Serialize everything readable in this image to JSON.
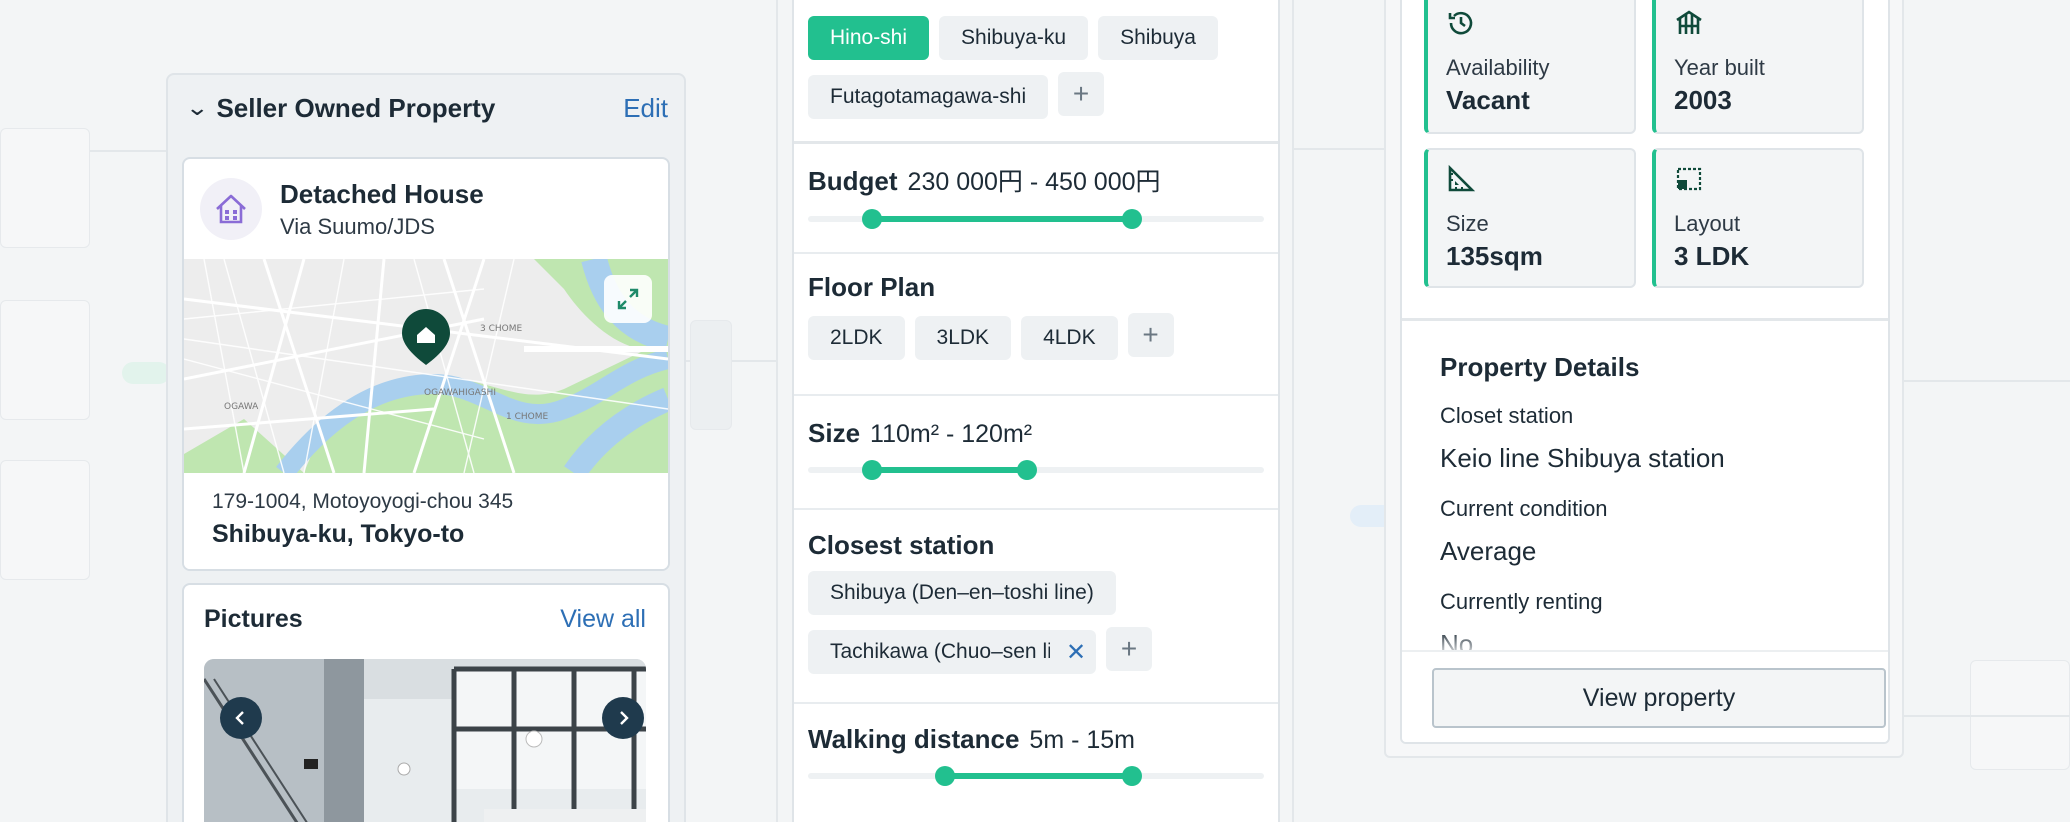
{
  "seller_card": {
    "title": "Seller Owned Property",
    "edit_label": "Edit",
    "property_type": "Detached House",
    "source": "Via Suumo/JDS",
    "address_line1": "179-1004, Motoyoyogi-chou 345",
    "address_line2": "Shibuya-ku, Tokyo-to",
    "pictures_title": "Pictures",
    "view_all_label": "View all"
  },
  "filters": {
    "areas": [
      "Hino-shi",
      "Shibuya-ku",
      "Shibuya",
      "Futagotamagawa-shi"
    ],
    "active_area": "Hino-shi",
    "budget": {
      "label": "Budget",
      "value": "230 000円 - 450 000円",
      "range": [
        0.14,
        0.71
      ]
    },
    "floor_plan": {
      "label": "Floor Plan",
      "options": [
        "2LDK",
        "3LDK",
        "4LDK"
      ]
    },
    "size": {
      "label": "Size",
      "value": "110m² - 120m²",
      "range": [
        0.14,
        0.48
      ]
    },
    "closest_station": {
      "label": "Closest station",
      "options": [
        "Shibuya (Den–en–toshi line)",
        "Tachikawa (Chuo–sen line)"
      ]
    },
    "walking_distance": {
      "label": "Walking distance",
      "value": "5m - 15m",
      "range": [
        0.3,
        0.71
      ]
    }
  },
  "property": {
    "stats": [
      {
        "icon": "clock-history-icon",
        "label": "Availability",
        "value": "Vacant"
      },
      {
        "icon": "building-frame-icon",
        "label": "Year built",
        "value": "2003"
      },
      {
        "icon": "ruler-triangle-icon",
        "label": "Size",
        "value": "135sqm"
      },
      {
        "icon": "layout-icon",
        "label": "Layout",
        "value": "3 LDK"
      }
    ],
    "details_title": "Property Details",
    "details": [
      {
        "label": "Closet station",
        "value": "Keio line Shibuya station"
      },
      {
        "label": "Current condition",
        "value": "Average"
      },
      {
        "label": "Currently renting",
        "value": "No"
      }
    ],
    "view_button_label": "View property"
  },
  "map_labels": [
    "OGAWA",
    "OGAWAHIGASHI",
    "3 CHOME",
    "1 CHOME"
  ],
  "colors": {
    "accent": "#22c08f",
    "link": "#2d6fb5",
    "text": "#1d2b36",
    "pin": "#0f4a3a",
    "house_icon": "#8a6cd6"
  }
}
